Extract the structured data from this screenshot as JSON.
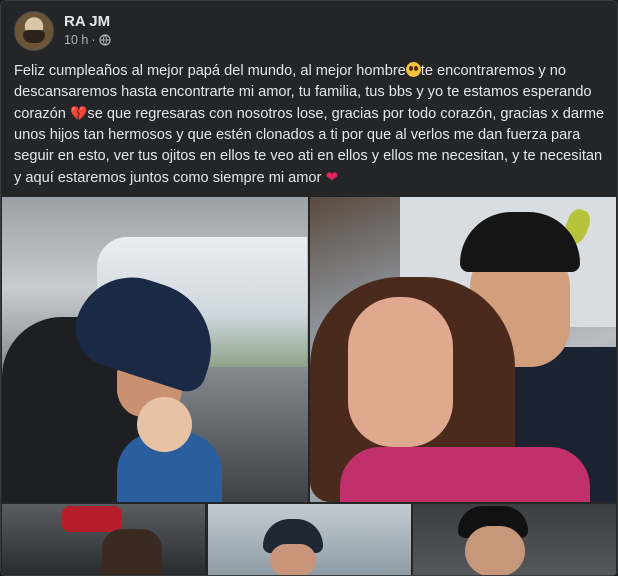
{
  "post": {
    "author": "RA JM",
    "time": "10 h",
    "separator": "·",
    "audience_icon": "globe-icon",
    "text_1": "Feliz cumpleaños al mejor papá del mundo, al mejor hombre",
    "text_2": "te encontraremos y no descansaremos hasta encontrarte mi amor, tu familia, tus bbs y yo te estamos esperando corazón ",
    "text_3": "se que regresaras con nosotros lose, gracias por todo corazón, gracias x darme unos hijos tan hermosos y que estén clonados a ti por que al verlos me dan fuerza para seguir en esto, ver tus ojitos en ellos te veo ati en ellos y ellos me necesitan, y te necesitan y aquí estaremos juntos como siempre mi amor ",
    "emoji_1": "pleading-face",
    "emoji_2": "💔",
    "emoji_3": "❤"
  },
  "colors": {
    "background": "#242526",
    "text": "#e4e6eb",
    "secondary_text": "#b0b3b8",
    "heart": "#e0245e"
  }
}
